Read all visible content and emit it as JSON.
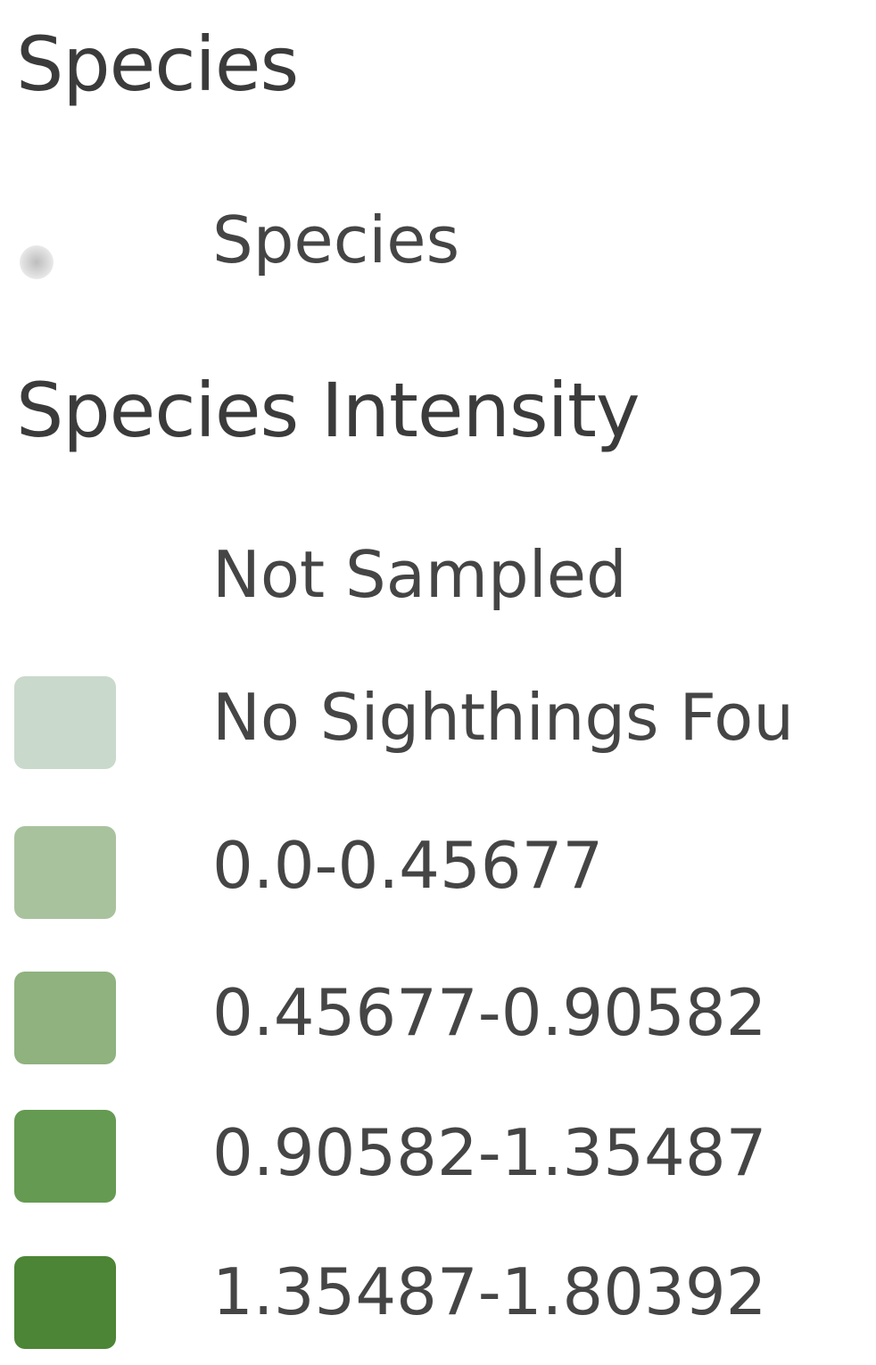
{
  "legend": {
    "group1": {
      "title": "Species",
      "items": [
        {
          "label": "Species",
          "symbol": "point",
          "color": "#c4c4c4"
        }
      ]
    },
    "group2": {
      "title": "Species Intensity",
      "items": [
        {
          "label": "Not Sampled",
          "color": "#ffffff"
        },
        {
          "label": "No Sighthings Fou",
          "color": "#c9d9cc"
        },
        {
          "label": "0.0-0.45677",
          "color": "#a9c29e"
        },
        {
          "label": "0.45677-0.90582",
          "color": "#8fb27f"
        },
        {
          "label": "0.90582-1.35487",
          "color": "#659a52"
        },
        {
          "label": "1.35487-1.80392",
          "color": "#4c8535"
        }
      ]
    }
  }
}
